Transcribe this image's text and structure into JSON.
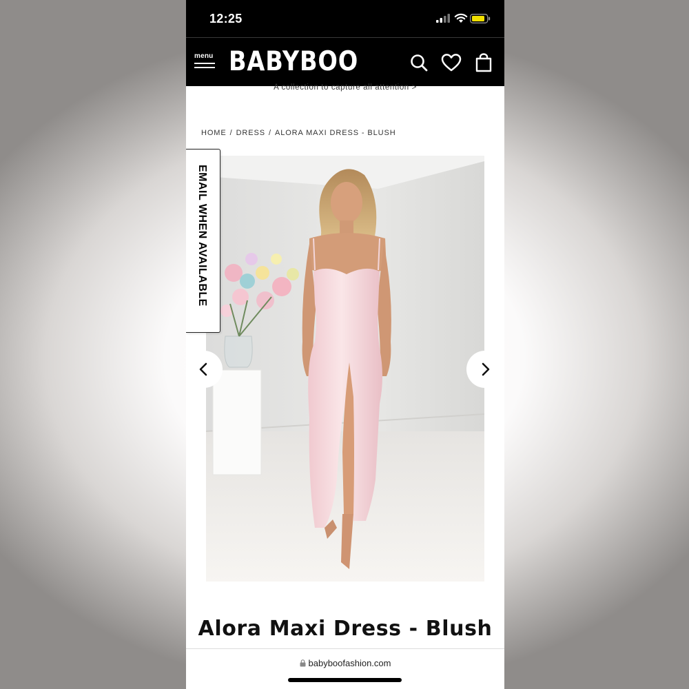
{
  "status_bar": {
    "time": "12:25"
  },
  "header": {
    "menu_label": "menu",
    "brand": "BABYBOO"
  },
  "promo": {
    "text": "A collection to capture all attention >"
  },
  "breadcrumb": {
    "items": [
      "HOME",
      "DRESS",
      "ALORA MAXI DRESS - BLUSH"
    ],
    "separator": "/"
  },
  "gallery": {
    "email_tab_label": "EMAIL WHEN AVAILABLE"
  },
  "product": {
    "title": "Alora Maxi Dress - Blush"
  },
  "browser": {
    "url": "babyboofashion.com"
  },
  "colors": {
    "header_bg": "#000000",
    "dress": "#f6d9dc",
    "wall": "#e3e3e1",
    "floor": "#f3f1ee"
  },
  "icons": [
    "signal-icon",
    "wifi-icon",
    "battery-icon",
    "menu-icon",
    "search-icon",
    "heart-icon",
    "bag-icon",
    "chevron-left-icon",
    "chevron-right-icon",
    "lock-icon"
  ]
}
